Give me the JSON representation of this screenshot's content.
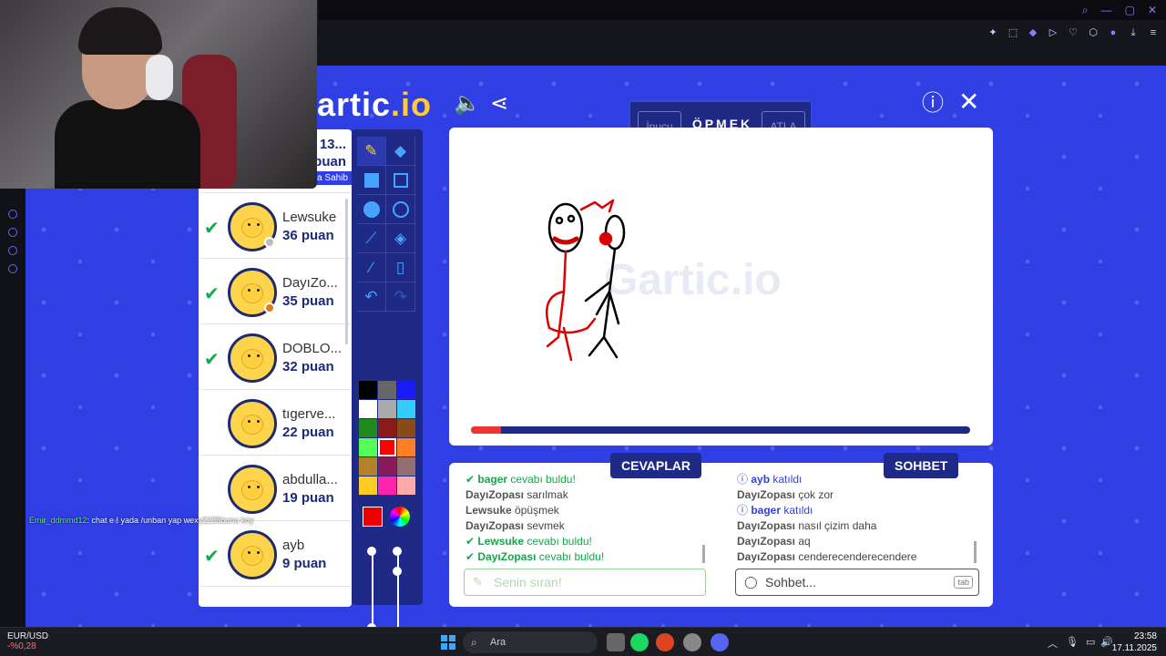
{
  "browser": {
    "window_controls": [
      "search-icon",
      "minimize-icon",
      "maximize-icon",
      "close-icon"
    ],
    "toolbar_icons": [
      "pin-icon",
      "screenshot-icon",
      "shield-icon",
      "play-icon",
      "heart-icon",
      "cube-icon",
      "user-icon",
      "download-icon",
      "menu-icon"
    ]
  },
  "stream": {
    "chat_user": "Emir_ddmmd12",
    "chat_message": ": chat e ! yada /unban yap wexy2235bunu koy"
  },
  "game": {
    "logo_text": "artic",
    "logo_suffix": ".io",
    "word_hint": "İpucu",
    "word": "ÖPMEK",
    "word_skip": "ATLA",
    "timer_progress": 0.06,
    "players_header": {
      "score_fragment": "13...",
      "puan_fragment": "puan",
      "owner_badge": "a Sahib"
    },
    "players": [
      {
        "name": "Lewsuke",
        "score": "36 puan",
        "found": true,
        "status_color": "#bdbdbd"
      },
      {
        "name": "DayıZo...",
        "score": "35 puan",
        "found": true,
        "status_color": "#e07b1a"
      },
      {
        "name": "DOBLO...",
        "score": "32 puan",
        "found": true,
        "status_color": ""
      },
      {
        "name": "tıgerve...",
        "score": "22 puan",
        "found": false,
        "status_color": ""
      },
      {
        "name": "abdulla...",
        "score": "19 puan",
        "found": false,
        "status_color": ""
      },
      {
        "name": "ayb",
        "score": "9 puan",
        "found": true,
        "status_color": ""
      }
    ],
    "palette": [
      "#000000",
      "#666666",
      "#1a1aff",
      "#ffffff",
      "#aaaaaa",
      "#33ccff",
      "#1f8b1f",
      "#8b1a1a",
      "#8b4a1a",
      "#55ff55",
      "#ff0000",
      "#ff7f27",
      "#b5802a",
      "#8b1a5a",
      "#8f6f6f",
      "#ffcc22",
      "#ff22aa",
      "#ffaaaa"
    ],
    "selected_color": "#ff0000",
    "tabs": {
      "answers": "CEVAPLAR",
      "chat": "SOHBET"
    },
    "answers": [
      {
        "user": "bager",
        "text": "cevabı buldu!",
        "type": "found"
      },
      {
        "user": "DayıZopası",
        "text": "sarılmak",
        "type": "guess"
      },
      {
        "user": "Lewsuke",
        "text": "öpüşmek",
        "type": "guess"
      },
      {
        "user": "DayıZopası",
        "text": "sevmek",
        "type": "guess"
      },
      {
        "user": "Lewsuke",
        "text": "cevabı buldu!",
        "type": "found"
      },
      {
        "user": "DayıZopası",
        "text": "cevabı buldu!",
        "type": "found"
      }
    ],
    "chat": [
      {
        "user": "ayb",
        "text": "katıldı",
        "type": "join"
      },
      {
        "user": "DayıZopası",
        "text": "çok zor",
        "type": "msg"
      },
      {
        "user": "bager",
        "text": "katıldı",
        "type": "join"
      },
      {
        "user": "DayıZopası",
        "text": "nasıl çizim daha",
        "type": "msg"
      },
      {
        "user": "DayıZopası",
        "text": "aq",
        "type": "msg"
      },
      {
        "user": "DayıZopası",
        "text": "cenderecenderecendere",
        "type": "msg"
      }
    ],
    "answer_placeholder": "Senin sıran!",
    "chat_placeholder": "Sohbet...",
    "chat_key_hint": "tab"
  },
  "taskbar": {
    "ticker_name": "EUR/USD",
    "ticker_change": "-%0,28",
    "search_label": "Ara",
    "time": "23:58",
    "date": "17.11.2025"
  }
}
